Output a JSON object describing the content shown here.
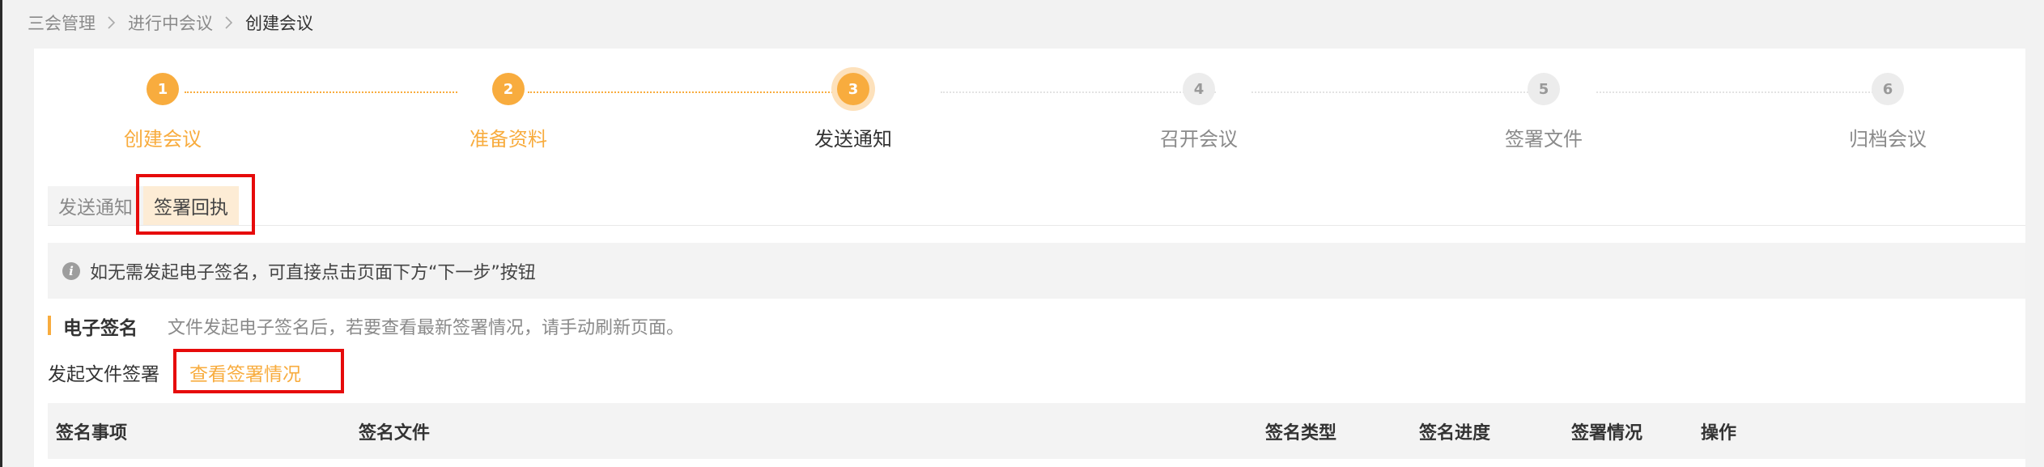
{
  "breadcrumb": {
    "items": [
      "三会管理",
      "进行中会议"
    ],
    "current": "创建会议"
  },
  "steps": [
    {
      "number": "1",
      "label": "创建会议",
      "state": "done"
    },
    {
      "number": "2",
      "label": "准备资料",
      "state": "done"
    },
    {
      "number": "3",
      "label": "发送通知",
      "state": "active"
    },
    {
      "number": "4",
      "label": "召开会议",
      "state": "pending"
    },
    {
      "number": "5",
      "label": "签署文件",
      "state": "pending"
    },
    {
      "number": "6",
      "label": "归档会议",
      "state": "pending"
    }
  ],
  "tabs": [
    {
      "label": "发送通知",
      "active": false
    },
    {
      "label": "签署回执",
      "active": true
    }
  ],
  "notice": {
    "icon": "info-icon",
    "text": "如无需发起电子签名，可直接点击页面下方“下一步”按钮"
  },
  "esign": {
    "title": "电子签名",
    "description": "文件发起电子签名后，若要查看最新签署情况，请手动刷新页面。",
    "initiate_label": "发起文件签署",
    "view_link": "查看签署情况"
  },
  "table": {
    "columns": [
      "签名事项",
      "签名文件",
      "签名类型",
      "签名进度",
      "签署情况",
      "操作"
    ]
  },
  "colors": {
    "accent": "#f8ac3e",
    "accent_light": "#fdecd5",
    "highlight": "#e60b0b"
  }
}
